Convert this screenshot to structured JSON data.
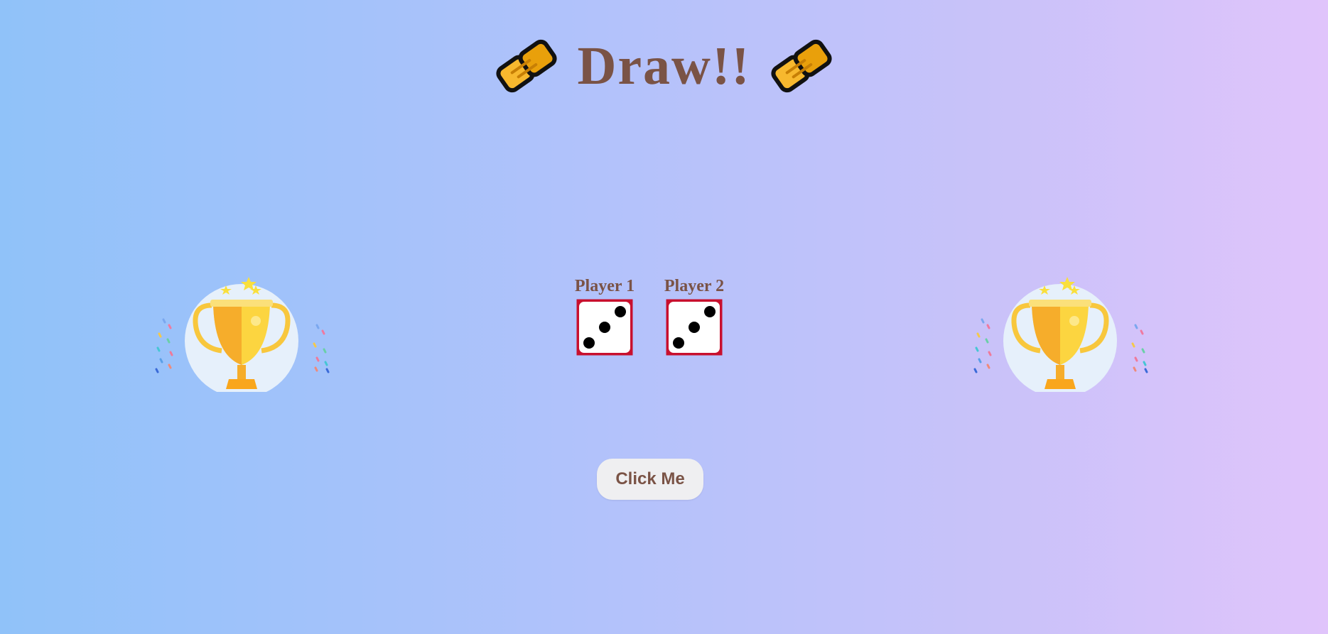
{
  "result": {
    "title": "Draw!!",
    "icon": "handshake-icon"
  },
  "players": [
    {
      "label": "Player 1",
      "die_value": 3
    },
    {
      "label": "Player 2",
      "die_value": 3
    }
  ],
  "button": {
    "label": "Click Me"
  },
  "decorations": {
    "left": "trophy-icon",
    "right": "trophy-icon"
  },
  "colors": {
    "text": "#7a5346",
    "die_border": "#c8102e",
    "gradient_start": "#90c2f9",
    "gradient_end": "#e0c4fb"
  }
}
